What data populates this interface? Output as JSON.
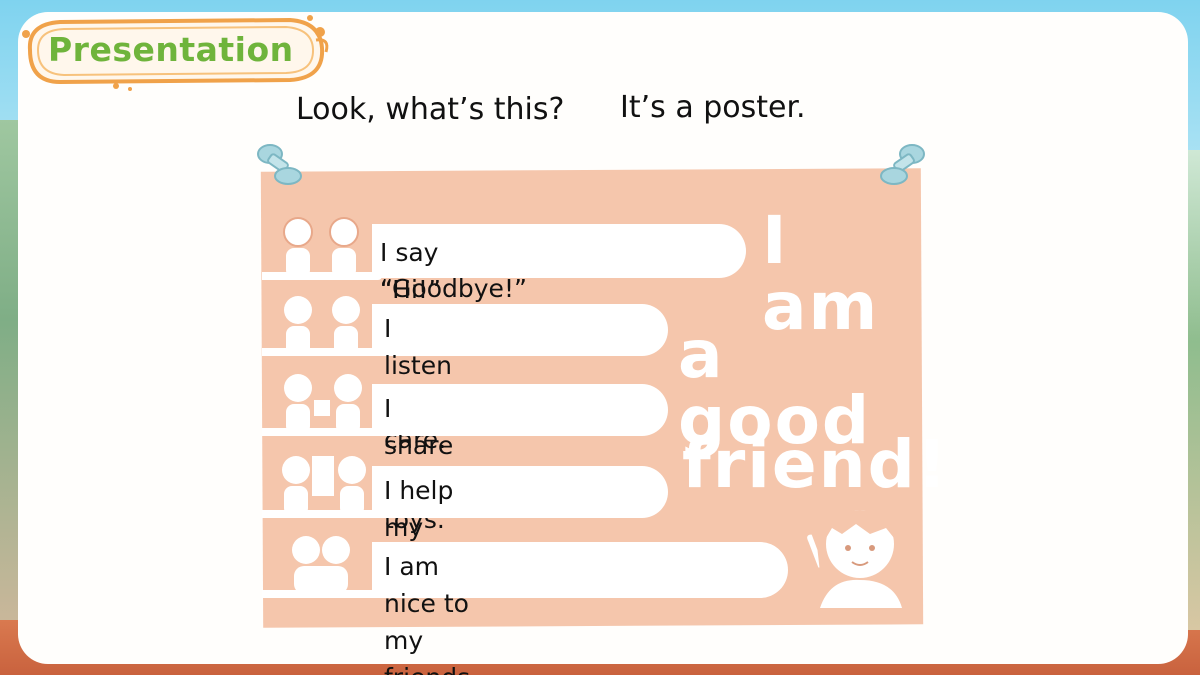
{
  "header": {
    "badge_label": "Presentation"
  },
  "dialogue": {
    "question": "Look, what’s this?",
    "answer": "It’s a poster."
  },
  "poster": {
    "rows": [
      {
        "line1": "I say “Hi!” and",
        "line2": "“Goodbye!”"
      },
      {
        "line1": "I listen with care."
      },
      {
        "line1": "I share my toys."
      },
      {
        "line1": "I help my friends."
      },
      {
        "line1": "I am nice to my friends."
      }
    ],
    "slogan": {
      "line1": "I am",
      "line2": "a good",
      "line3": "friend!"
    }
  },
  "colors": {
    "poster": "#f5c6ac",
    "badge_text": "#6fb43c",
    "badge_border": "#f0a24a",
    "pin": "#a9d6df"
  }
}
